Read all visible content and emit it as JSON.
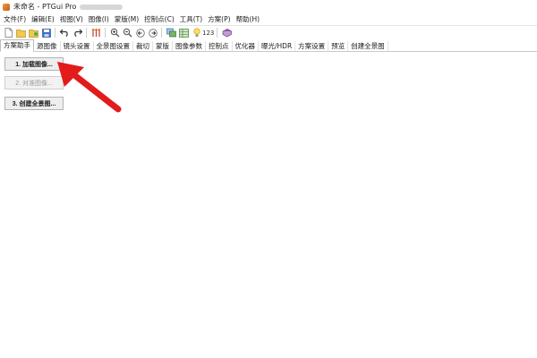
{
  "window": {
    "title": "未命名 - PTGui Pro"
  },
  "menu": [
    "文件(F)",
    "编辑(E)",
    "视图(V)",
    "图像(I)",
    "蒙版(M)",
    "控制点(C)",
    "工具(T)",
    "方案(P)",
    "帮助(H)"
  ],
  "toolbar": {
    "zoom_label": "123"
  },
  "tabs": [
    "方案助手",
    "源图像",
    "镜头设置",
    "全景图设置",
    "裁切",
    "蒙版",
    "图像参数",
    "控制点",
    "优化器",
    "曝光/HDR",
    "方案设置",
    "预览",
    "创建全景图"
  ],
  "wizard": {
    "load_images": "1. 加载图像...",
    "align_images": "2. 对准图像...",
    "create_panorama": "3. 创建全景图..."
  },
  "colors": {
    "arrow": "#e21b1b"
  }
}
